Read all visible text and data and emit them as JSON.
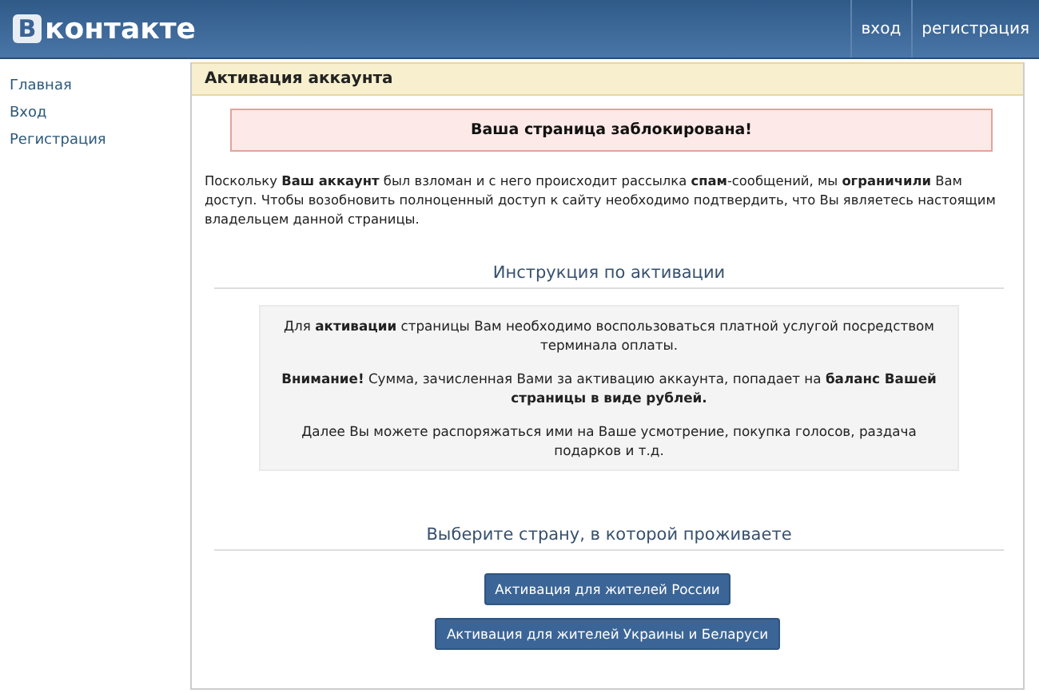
{
  "header": {
    "logo_mark": "В",
    "logo_text": "контакте",
    "links": [
      "вход",
      "регистрация"
    ]
  },
  "sidebar": {
    "items": [
      "Главная",
      "Вход",
      "Регистрация"
    ]
  },
  "card": {
    "title": "Активация аккаунта",
    "alert": "Ваша страница заблокирована!",
    "intro": "Поскольку **Ваш аккаунт** был взломан и с него происходит рассылка **спам**-сообщений, мы **ограничили** Вам доступ. Чтобы возобновить полноценный доступ к сайту необходимо подтвердить, что Вы являетесь настоящим владельцем данной страницы.",
    "instructions_heading": "Инструкция по активации",
    "instructions": [
      "Для **активации** страницы Вам необходимо воспользоваться платной услугой посредством терминала оплаты.",
      "**Внимание!** Сумма, зачисленная Вами за активацию аккаунта, попадает на **баланс Вашей страницы в виде рублей.**",
      "Далее Вы можете распоряжаться ими на Ваше усмотрение, покупка голосов, раздача подарков и т.д."
    ],
    "country_heading": "Выберите страну, в которой проживаете",
    "buttons": [
      "Активация для жителей России",
      "Активация для жителей Украины и Беларуси"
    ]
  }
}
